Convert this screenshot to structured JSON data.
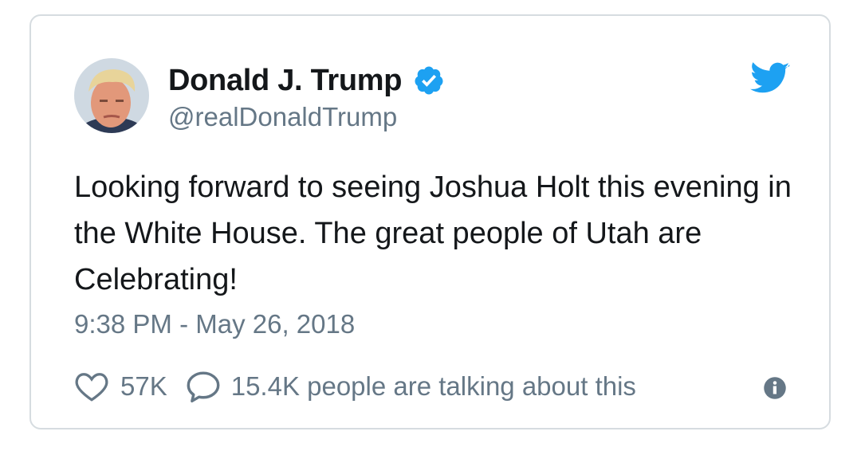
{
  "tweet": {
    "author": {
      "display_name": "Donald J. Trump",
      "handle": "@realDonaldTrump",
      "verified": true
    },
    "text": "Looking forward to seeing Joshua Holt this evening in the White House. The great people of Utah are Celebrating!",
    "timestamp": "9:38 PM - May 26, 2018",
    "likes": "57K",
    "talking": "15.4K people are talking about this"
  },
  "icons": {
    "verified": "verified-badge-icon",
    "brand": "twitter-bird-icon",
    "like": "heart-icon",
    "reply": "speech-bubble-icon",
    "info": "info-icon"
  },
  "colors": {
    "brand_blue": "#1da1f2",
    "text_primary": "#14171a",
    "text_secondary": "#657786",
    "border": "#d6dce0"
  }
}
